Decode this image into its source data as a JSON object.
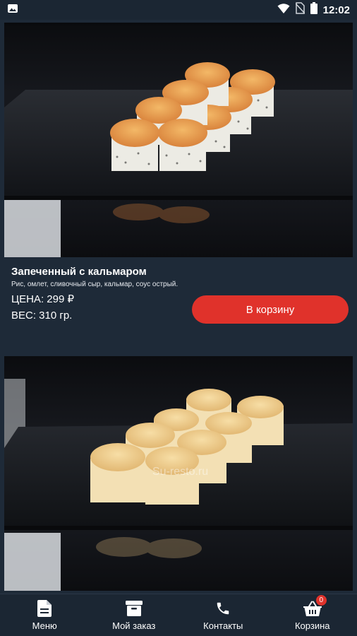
{
  "status_bar": {
    "time": "12:02",
    "icons": [
      "image-icon",
      "wifi-icon",
      "no-sim-icon",
      "battery-icon"
    ]
  },
  "products": [
    {
      "title": "Запеченный с кальмаром",
      "description": "Рис, омлет, сливочный сыр, кальмар, соус острый.",
      "price": "ЦЕНА: 299 ₽",
      "weight": "ВЕС: 310 гр.",
      "button_label": "В корзину"
    }
  ],
  "second_product_image_watermark": "Su-resto.ru",
  "tab_bar": {
    "items": [
      {
        "label": "Меню",
        "icon": "document-icon"
      },
      {
        "label": "Мой заказ",
        "icon": "archive-box-icon"
      },
      {
        "label": "Контакты",
        "icon": "phone-icon"
      },
      {
        "label": "Корзина",
        "icon": "shopping-basket-icon",
        "badge": "0"
      }
    ]
  },
  "colors": {
    "background": "#1e2a38",
    "bar": "#1b2633",
    "accent": "#e0322b"
  }
}
